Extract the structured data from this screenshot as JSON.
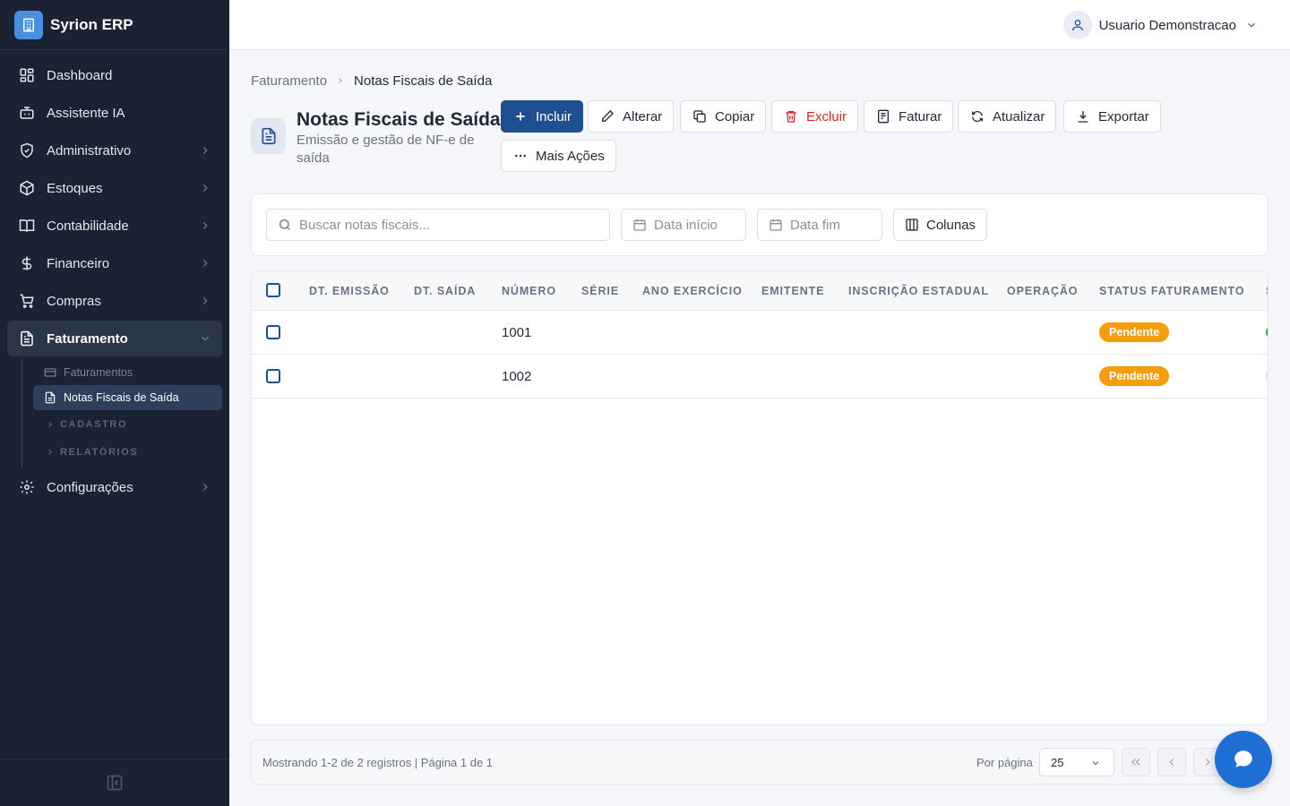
{
  "app": {
    "name": "Syrion ERP",
    "logo_icon": "building-icon"
  },
  "sidebar": {
    "items": [
      {
        "label": "Dashboard",
        "icon": "grid-icon"
      },
      {
        "label": "Assistente IA",
        "icon": "bot-icon"
      },
      {
        "label": "Administrativo",
        "icon": "shield-icon",
        "expandable": true
      },
      {
        "label": "Estoques",
        "icon": "box-icon",
        "expandable": true
      },
      {
        "label": "Contabilidade",
        "icon": "book-icon",
        "expandable": true
      },
      {
        "label": "Financeiro",
        "icon": "dollar-icon",
        "expandable": true
      },
      {
        "label": "Compras",
        "icon": "cart-icon",
        "expandable": true
      },
      {
        "label": "Faturamento",
        "icon": "receipt-icon",
        "expandable": true,
        "expanded": true
      },
      {
        "label": "Configurações",
        "icon": "gear-icon",
        "expandable": true
      }
    ],
    "sub_items": [
      {
        "label": "Faturamentos",
        "icon": "card-icon"
      },
      {
        "label": "Notas Fiscais de Saída",
        "icon": "document-icon",
        "active": true
      }
    ],
    "sub_groups": [
      "CADASTRO",
      "RELATÓRIOS"
    ]
  },
  "topbar": {
    "user_name": "Usuario Demonstracao"
  },
  "breadcrumb": {
    "parent": "Faturamento",
    "current": "Notas Fiscais de Saída"
  },
  "page": {
    "title": "Notas Fiscais de Saída",
    "subtitle": "Emissão e gestão de NF-e de saída"
  },
  "toolbar": {
    "include": "Incluir",
    "edit": "Alterar",
    "copy": "Copiar",
    "delete": "Excluir",
    "invoice": "Faturar",
    "refresh": "Atualizar",
    "export": "Exportar",
    "more": "Mais Ações"
  },
  "filters": {
    "search_placeholder": "Buscar notas fiscais...",
    "date_start": "Data início",
    "date_end": "Data fim",
    "columns": "Colunas"
  },
  "table": {
    "columns": [
      "DT. EMISSÃO",
      "DT. SAÍDA",
      "NÚMERO",
      "SÉRIE",
      "ANO EXERCÍCIO",
      "EMITENTE",
      "INSCRIÇÃO ESTADUAL",
      "OPERAÇÃO",
      "STATUS FATURAMENTO",
      "S"
    ],
    "rows": [
      {
        "dt_emissao": "",
        "dt_saida": "",
        "numero": "1001",
        "serie": "",
        "ano_exercicio": "",
        "emitente": "",
        "inscricao_estadual": "",
        "operacao": "",
        "status": "Pendente"
      },
      {
        "dt_emissao": "",
        "dt_saida": "",
        "numero": "1002",
        "serie": "",
        "ano_exercicio": "",
        "emitente": "",
        "inscricao_estadual": "",
        "operacao": "",
        "status": "Pendente"
      }
    ]
  },
  "pagination": {
    "info": "Mostrando 1-2 de 2 registros | Página 1 de 1",
    "per_page_label": "Por página",
    "per_page": "25"
  },
  "colors": {
    "sidebar_bg": "#1a2233",
    "primary": "#1d4f91",
    "danger": "#dc2626",
    "status_pending": "#f59e0b",
    "fab": "#1d6fd6"
  }
}
